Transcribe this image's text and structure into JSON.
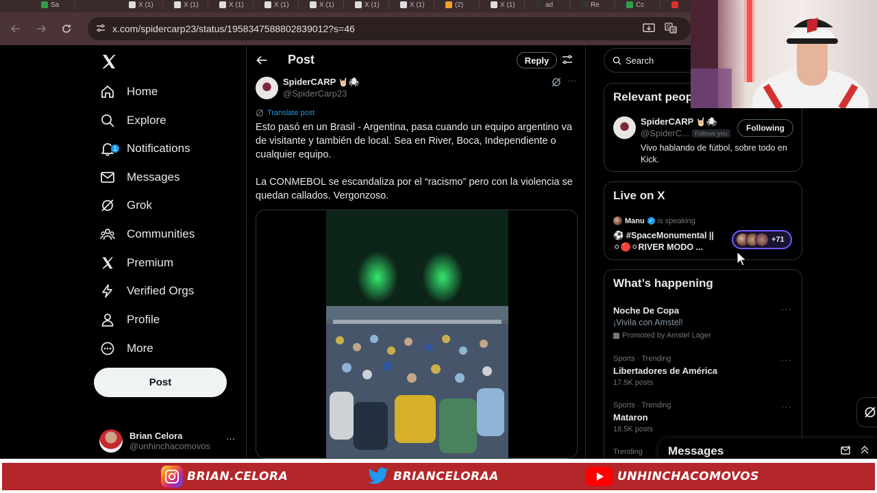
{
  "browser": {
    "url": "x.com/spidercarp23/status/1958347588802839012?s=46",
    "tabs": [
      "Sa",
      "X (1)",
      "X (1)",
      "X (1)",
      "X (1)",
      "X (1)",
      "X (1)",
      "X (1)",
      "(2)",
      "X (1)",
      "ad",
      "Re",
      "Cc",
      ""
    ]
  },
  "leftnav": {
    "items": [
      {
        "label": "Home",
        "icon": "home-icon"
      },
      {
        "label": "Explore",
        "icon": "search-icon"
      },
      {
        "label": "Notifications",
        "icon": "bell-icon",
        "badge": "1"
      },
      {
        "label": "Messages",
        "icon": "envelope-icon"
      },
      {
        "label": "Grok",
        "icon": "grok-icon"
      },
      {
        "label": "Communities",
        "icon": "people-icon"
      },
      {
        "label": "Premium",
        "icon": "x-icon"
      },
      {
        "label": "Verified Orgs",
        "icon": "lightning-icon"
      },
      {
        "label": "Profile",
        "icon": "person-icon"
      },
      {
        "label": "More",
        "icon": "more-circle-icon"
      }
    ],
    "post_button": "Post",
    "account": {
      "name": "Brian Celora",
      "handle": "@unhinchacomovos",
      "more": "···"
    }
  },
  "main": {
    "header_title": "Post",
    "reply_label": "Reply",
    "author": {
      "name": "SpiderCARP",
      "emoji": "🤘🏻🕷",
      "handle": "@SpiderCarp23"
    },
    "translate": "Translate post",
    "text1": "Esto pasó en un Brasil - Argentina, pasa cuando un equipo argentino va de visitante y también de local. Sea en River, Boca, Independiente o cualquier equipo.",
    "text2": "La CONMEBOL se escandaliza por el “racismo” pero con la violencia se quedan callados. Vergonzoso."
  },
  "right": {
    "search_placeholder": "Search",
    "relevant": {
      "title": "Relevant people",
      "name": "SpiderCARP",
      "emoji": "🤘🏻🕷",
      "handle": "@SpiderC...",
      "follows_you": "Follows you",
      "follow_label": "Following",
      "bio": "Vivo hablando de fútbol, sobre todo en Kick."
    },
    "live": {
      "title": "Live on X",
      "host": "Manu",
      "status": "is speaking",
      "space_title": "⚽ #SpaceMonumental || ⚪🔴⚪RIVER MODO ...",
      "listeners": "+71"
    },
    "happening": {
      "title": "What’s happening",
      "promo": {
        "name": "Noche De Copa",
        "desc": "¡Vivila con Amstel!",
        "promoted": "Promoted by Amstel Lager"
      },
      "trends": [
        {
          "category": "Sports · Trending",
          "name": "Libertadores de América",
          "posts": "17.5K posts"
        },
        {
          "category": "Sports · Trending",
          "name": "Mataron",
          "posts": "18.5K posts"
        },
        {
          "category": "Trending",
          "name": "",
          "posts": ""
        }
      ]
    }
  },
  "messages_drawer": {
    "title": "Messages"
  },
  "banner": {
    "instagram": "BRIAN.CELORA",
    "twitter": "BRIANCELORAA",
    "youtube": "UNHINCHACOMOVOS"
  },
  "colors": {
    "accent": "#1d9bf0",
    "banner_red": "#b3262a",
    "live_purple": "#7856ff"
  }
}
